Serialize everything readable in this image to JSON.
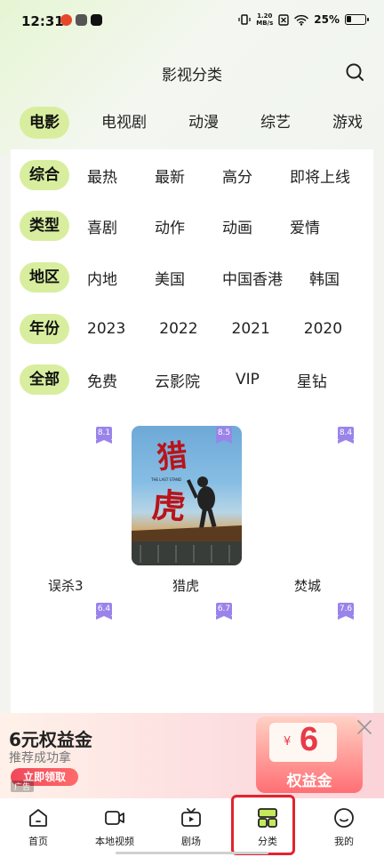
{
  "status_bar": {
    "time": "12:31",
    "net_speed_value": "1.20",
    "net_speed_unit": "MB/s",
    "battery": "25%"
  },
  "header": {
    "title": "影视分类"
  },
  "main_tabs": [
    "电影",
    "电视剧",
    "动漫",
    "综艺",
    "游戏"
  ],
  "filters": [
    {
      "label": "综合",
      "options": [
        "最热",
        "最新",
        "高分",
        "即将上线"
      ]
    },
    {
      "label": "类型",
      "options": [
        "喜剧",
        "动作",
        "动画",
        "爱情"
      ]
    },
    {
      "label": "地区",
      "options": [
        "内地",
        "美国",
        "中国香港",
        "韩国"
      ]
    },
    {
      "label": "年份",
      "options": [
        "2023",
        "2022",
        "2021",
        "2020"
      ]
    },
    {
      "label": "全部",
      "options": [
        "免费",
        "云影院",
        "VIP",
        "星钻"
      ]
    }
  ],
  "movies_row1": [
    {
      "title": "误杀3",
      "rating": "8.1"
    },
    {
      "title": "猎虎",
      "rating": "8.5"
    },
    {
      "title": "焚城",
      "rating": "8.4"
    }
  ],
  "movies_row2_ratings": [
    "6.4",
    "6.7",
    "7.6"
  ],
  "poster": {
    "title_art": "猎虎",
    "tagline": "THE LAST STAND"
  },
  "ad": {
    "title": "6元权益金",
    "subtitle": "推荐成功拿",
    "cta": "立即领取",
    "tag": "广告",
    "coupon_currency": "¥",
    "coupon_amount": "6",
    "coupon_label": "权益金"
  },
  "bottom_nav": [
    {
      "label": "首页",
      "icon": "home-icon"
    },
    {
      "label": "本地视频",
      "icon": "local-video-icon"
    },
    {
      "label": "剧场",
      "icon": "tv-icon"
    },
    {
      "label": "分类",
      "icon": "category-icon"
    },
    {
      "label": "我的",
      "icon": "profile-icon"
    }
  ],
  "colors": {
    "accent": "#d8ee9e",
    "rating": "#9a84ea",
    "highlight": "#e0242f"
  }
}
